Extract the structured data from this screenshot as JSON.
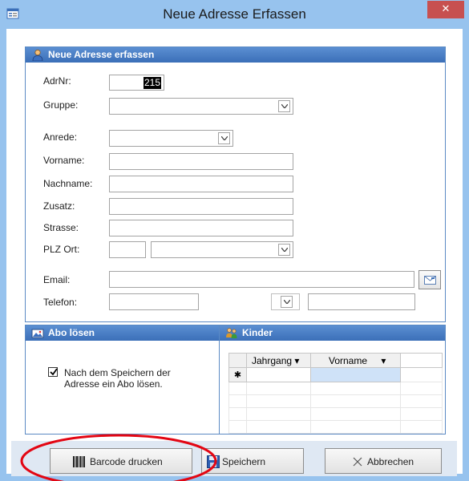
{
  "window": {
    "title": "Neue Adresse Erfassen",
    "close_glyph": "✕"
  },
  "main_panel": {
    "header": "Neue Adresse erfassen"
  },
  "fields": {
    "adrnr": {
      "label": "AdrNr:",
      "value": "215"
    },
    "gruppe": {
      "label": "Gruppe:",
      "value": ""
    },
    "anrede": {
      "label": "Anrede:",
      "value": ""
    },
    "vorname": {
      "label": "Vorname:",
      "value": ""
    },
    "nachname": {
      "label": "Nachname:",
      "value": ""
    },
    "zusatz": {
      "label": "Zusatz:",
      "value": ""
    },
    "strasse": {
      "label": "Strasse:",
      "value": ""
    },
    "plz_ort": {
      "label": "PLZ Ort:",
      "plz": "",
      "ort": ""
    },
    "email": {
      "label": "Email:",
      "value": ""
    },
    "telefon": {
      "label": "Telefon:",
      "value": "",
      "extra": ""
    }
  },
  "abo_panel": {
    "header": "Abo lösen",
    "checkbox_checked": true,
    "checkbox_line1": "Nach dem Speichern der",
    "checkbox_line2": "Adresse ein Abo lösen."
  },
  "kinder_panel": {
    "header": "Kinder",
    "columns": [
      "Jahrgang",
      "Vorname"
    ],
    "new_record_glyph": "✱",
    "sort_glyph": "▾"
  },
  "buttons": {
    "barcode": "Barcode drucken",
    "speichern": "Speichern",
    "abbrechen": "Abbrechen"
  },
  "icons": {
    "app": "form-icon",
    "email": "envelope-icon",
    "barcode": "barcode-icon",
    "save": "floppy-disk-icon",
    "cancel": "cross-icon",
    "person": "person-icon",
    "abo": "ticket-icon",
    "kinder": "children-icon"
  },
  "colors": {
    "accent": "#3b6fb8",
    "title_bar": "#97c3ee",
    "close": "#c75050",
    "highlight_ring": "#e30613"
  }
}
